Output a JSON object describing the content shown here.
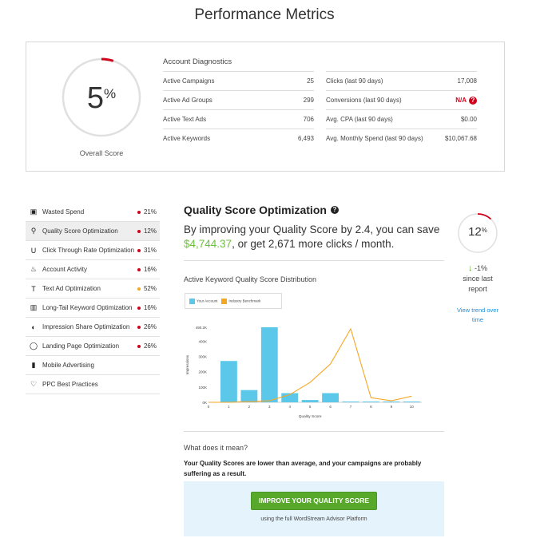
{
  "page_title": "Performance Metrics",
  "overall": {
    "value": "5",
    "unit": "%",
    "label": "Overall Score",
    "fraction": 0.05,
    "ring_color": "#d0021b"
  },
  "diagnostics": {
    "title": "Account Diagnostics",
    "left": [
      {
        "label": "Active Campaigns",
        "value": "25"
      },
      {
        "label": "Active Ad Groups",
        "value": "299"
      },
      {
        "label": "Active Text Ads",
        "value": "706"
      },
      {
        "label": "Active Keywords",
        "value": "6,493"
      }
    ],
    "right": [
      {
        "label": "Clicks (last 90 days)",
        "value": "17,008"
      },
      {
        "label": "Conversions (last 90 days)",
        "value": "N/A",
        "alert": true,
        "alert_icon": "?"
      },
      {
        "label": "Avg. CPA (last 90 days)",
        "value": "$0.00"
      },
      {
        "label": "Avg. Monthly Spend (last 90 days)",
        "value": "$10,067.68"
      }
    ]
  },
  "sidebar": {
    "items": [
      {
        "label": "Wasted Spend",
        "pct": "21%",
        "dot": "#d0021b",
        "icon": "wallet-icon",
        "glyph": "▣"
      },
      {
        "label": "Quality Score Optimization",
        "pct": "12%",
        "dot": "#d0021b",
        "icon": "gauge-icon",
        "glyph": "⚲",
        "active": true
      },
      {
        "label": "Click Through Rate Optimization",
        "pct": "31%",
        "dot": "#d0021b",
        "icon": "magnet-icon",
        "glyph": "U"
      },
      {
        "label": "Account Activity",
        "pct": "16%",
        "dot": "#d0021b",
        "icon": "flame-icon",
        "glyph": "♨"
      },
      {
        "label": "Text Ad Optimization",
        "pct": "52%",
        "dot": "#f5a623",
        "icon": "text-icon",
        "glyph": "T"
      },
      {
        "label": "Long-Tail Keyword Optimization",
        "pct": "16%",
        "dot": "#d0021b",
        "icon": "chart-icon",
        "glyph": "▥"
      },
      {
        "label": "Impression Share Optimization",
        "pct": "26%",
        "dot": "#d0021b",
        "icon": "pie-icon",
        "glyph": "◐"
      },
      {
        "label": "Landing Page Optimization",
        "pct": "26%",
        "dot": "#d0021b",
        "icon": "target-icon",
        "glyph": "◯"
      },
      {
        "label": "Mobile Advertising",
        "pct": "",
        "dot": "",
        "icon": "mobile-icon",
        "glyph": "▮"
      },
      {
        "label": "PPC Best Practices",
        "pct": "",
        "dot": "",
        "icon": "thumbs-up-icon",
        "glyph": "♡"
      }
    ]
  },
  "main": {
    "title": "Quality Score Optimization",
    "help_icon": "?",
    "text_before": "By improving your Quality Score by 2.4, you can save ",
    "save_amount": "$4,744.37",
    "text_after": ", or get 2,671 more clicks / month.",
    "save_color": "#6fbf3f",
    "dist_title": "Active Keyword Quality Score Distribution",
    "what_title": "What does it mean?",
    "description": "Your Quality Scores are lower than average, and your campaigns are probably suffering as a result.",
    "cta_label": "IMPROVE YOUR QUALITY SCORE",
    "cta_sub": "using the full WordStream Advisor Platform"
  },
  "score_widget": {
    "value": "12",
    "unit": "%",
    "fraction": 0.12,
    "change": "-1%",
    "change_suffix": "since last report",
    "trend_link": "View trend over time",
    "arrow": "↓"
  },
  "chart_data": {
    "type": "bar",
    "title": "",
    "xlabel": "Quality Score",
    "ylabel": "Impressions",
    "categories": [
      "0",
      "1",
      "2",
      "3",
      "4",
      "5",
      "6",
      "7",
      "8",
      "9",
      "10"
    ],
    "y_ticks": [
      "0K",
      "100K",
      "200K",
      "300K",
      "400K",
      "490.2K"
    ],
    "ylim": [
      0,
      490200
    ],
    "series": [
      {
        "name": "Your Account",
        "kind": "bar",
        "color": "#5bc8ea",
        "x": [
          1,
          2,
          3,
          4,
          5,
          6,
          7,
          8,
          9,
          10
        ],
        "values": [
          270000,
          80000,
          490200,
          60000,
          15000,
          60000,
          5000,
          5000,
          5000,
          5000
        ]
      },
      {
        "name": "Industry Benchmark",
        "kind": "line",
        "color": "#f5a623",
        "x": [
          0,
          1,
          2,
          3,
          4,
          5,
          6,
          7,
          8,
          9,
          10
        ],
        "values": [
          0,
          0,
          5000,
          10000,
          50000,
          130000,
          250000,
          480000,
          30000,
          10000,
          40000
        ]
      }
    ]
  }
}
